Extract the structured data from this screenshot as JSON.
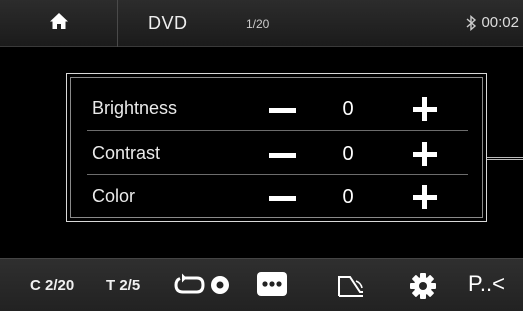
{
  "topbar": {
    "source": "DVD",
    "track_count": "1/20",
    "time": "00:02",
    "icons": [
      "home-icon",
      "bluetooth-icon"
    ]
  },
  "video_settings": {
    "rows": [
      {
        "label": "Brightness",
        "value": "0"
      },
      {
        "label": "Contrast",
        "value": "0"
      },
      {
        "label": "Color",
        "value": "0"
      }
    ]
  },
  "bottombar": {
    "chapter": "C 2/20",
    "title": "T 2/5",
    "more": "P..<",
    "icons": [
      "repeat-icon",
      "menu-dots-icon",
      "rotate-icon",
      "gear-icon"
    ]
  },
  "colors": {
    "background": "#000000",
    "bar": "#262626",
    "text": "#ffffff"
  }
}
